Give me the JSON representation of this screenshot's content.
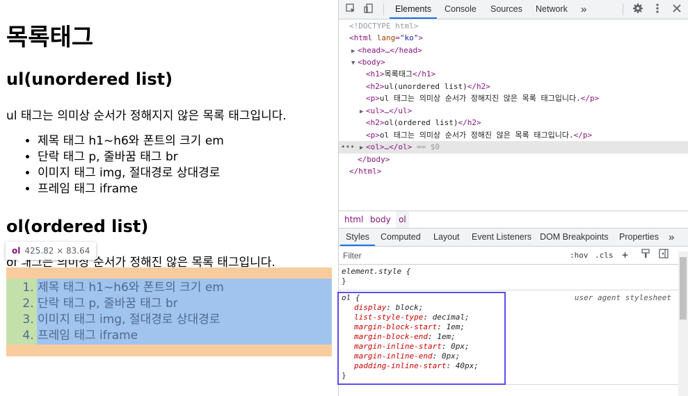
{
  "page": {
    "h1": "목록태그",
    "h2_ul": "ul(unordered list)",
    "p_ul": "ul 태그는 의미상 순서가 정해지지 않은 목록 태그입니다.",
    "ul_items": [
      "제목 태그 h1~h6와 폰트의 크기 em",
      "단락 태그 p, 줄바꿈 태그 br",
      "이미지 태그 img, 절대경로 상대경로",
      "프레임 태그 iframe"
    ],
    "h2_ol": "ol(ordered list)",
    "p_ol": "ol 태그는 의미상 순서가 정해진 않은 목록 태그입니다.",
    "ol_items": [
      "제목 태그 h1~h6와 폰트의 크기 em",
      "단락 태그 p, 줄바꿈 태그 br",
      "이미지 태그 img, 절대경로 상대경로",
      "프레임 태그 iframe"
    ],
    "tooltip": {
      "tag": "ol",
      "size": "425.82 × 83.64"
    }
  },
  "devtools": {
    "tabs": [
      "Elements",
      "Console",
      "Sources",
      "Network"
    ],
    "more": "»",
    "dom": {
      "doctype": "<!DOCTYPE html>",
      "html_open_tag": "<html",
      "html_attr": "lang",
      "html_attr_val": "\"ko\"",
      "html_close_bracket": ">",
      "head": "<head>…</head>",
      "body_open": "<body>",
      "h1_open": "<h1>",
      "h1_text": "목록태그",
      "h1_close": "</h1>",
      "h2a_open": "<h2>",
      "h2a_text": "ul(unordered list)",
      "h2a_close": "</h2>",
      "p1_open": "<p>",
      "p1_text": "ul 태그는 의미상 순서가 정해지진 않은 목록 태그입니다.",
      "p1_close": "</p>",
      "ul": "<ul>…</ul>",
      "h2b_open": "<h2>",
      "h2b_text": "ol(ordered list)",
      "h2b_close": "</h2>",
      "p2_open": "<p>",
      "p2_text": "ol 태그는 의미상 순서가 정해진 않은 목록 태그입니다.",
      "p2_close": "</p>",
      "ol": "<ol>…</ol>",
      "ol_marker": " == $0",
      "row_dots": "•••",
      "body_close": "</body>",
      "html_close": "</html>"
    },
    "breadcrumbs": [
      "html",
      "body",
      "ol"
    ],
    "subtabs": [
      "Styles",
      "Computed",
      "Layout",
      "Event Listeners",
      "DOM Breakpoints",
      "Properties"
    ],
    "filter_placeholder": "Filter",
    "filter_buttons": {
      "hov": ":hov",
      "cls": ".cls",
      "plus": "+"
    },
    "element_style": {
      "selector": "element.style {",
      "close": "}"
    },
    "ol_rule": {
      "selector": "ol {",
      "source": "user agent stylesheet",
      "decls": [
        {
          "prop": "display",
          "value": "block;"
        },
        {
          "prop": "list-style-type",
          "value": "decimal;"
        },
        {
          "prop": "margin-block-start",
          "value": "1em;"
        },
        {
          "prop": "margin-block-end",
          "value": "1em;"
        },
        {
          "prop": "margin-inline-start",
          "value": "0px;"
        },
        {
          "prop": "margin-inline-end",
          "value": "0px;"
        },
        {
          "prop": "padding-inline-start",
          "value": "40px;"
        }
      ],
      "close": "}"
    }
  },
  "colors": {
    "margin_overlay": "#f9cc9d",
    "padding_overlay": "#c3e0ab",
    "content_overlay": "#a0c4ee",
    "highlight_box": "#5b4cf0",
    "tab_accent": "#1a73e8"
  }
}
